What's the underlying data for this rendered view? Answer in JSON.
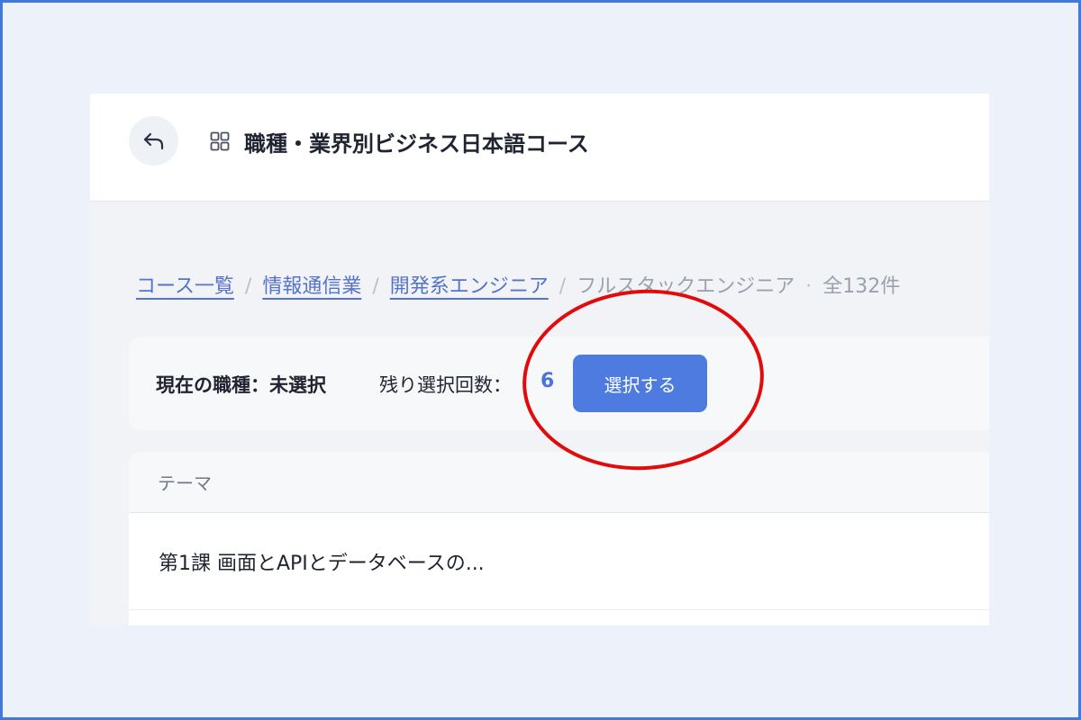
{
  "header": {
    "back_icon": "undo-arrow-icon",
    "grid_icon": "grid-icon",
    "title": "職種・業界別ビジネス日本語コース"
  },
  "breadcrumb": {
    "items": [
      "コース一覧",
      "情報通信業",
      "開発系エンジニア"
    ],
    "separator": "/",
    "current": "フルスタックエンジニア",
    "dot": "·",
    "count": "全132件"
  },
  "selection": {
    "current_label": "現在の職種：未選択",
    "remaining_label": "残り選択回数：",
    "remaining_count": "6",
    "button_label": "選択する"
  },
  "themes": {
    "header": "テーマ",
    "rows": [
      "第1課 画面とAPIとデータベースの..."
    ]
  },
  "colors": {
    "accent": "#4e7be0",
    "highlight": "#e20a0a",
    "frame": "#3f79de"
  }
}
